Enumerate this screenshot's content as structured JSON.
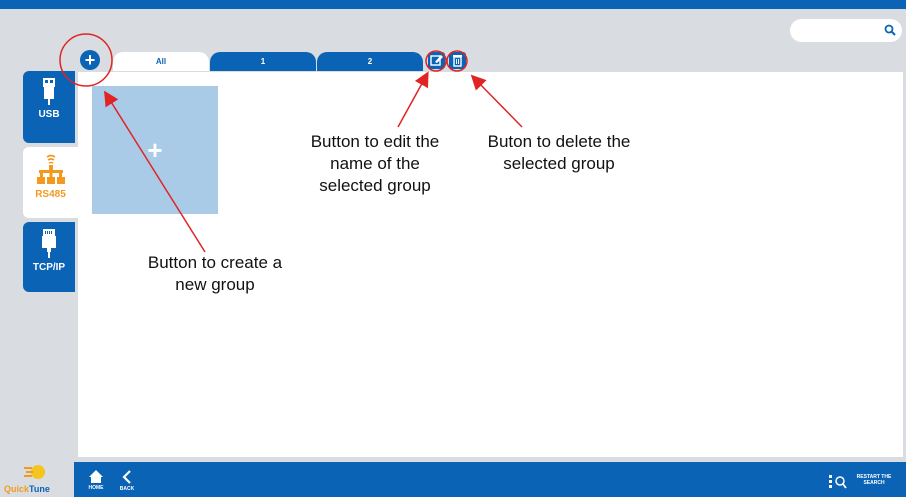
{
  "search": {
    "placeholder": ""
  },
  "sidebar": {
    "items": [
      {
        "label": "USB",
        "icon": "usb-icon",
        "active": false
      },
      {
        "label": "RS485",
        "icon": "rs485-network-icon",
        "active": true
      },
      {
        "label": "TCP/IP",
        "icon": "ethernet-icon",
        "active": false
      }
    ]
  },
  "tabs": [
    {
      "label": "All",
      "active": true
    },
    {
      "label": "1",
      "active": false
    },
    {
      "label": "2",
      "active": false
    }
  ],
  "annotations": {
    "create": "Button to create a new group",
    "edit": "Button to edit the name of the selected group",
    "delete": "Buton to delete the selected group"
  },
  "bottom": {
    "logo_text_quick": "Quick",
    "logo_text_tune": "Tune",
    "home_label": "HOME",
    "back_label": "BACK",
    "restart_label": "RESTART THE SEARCH"
  },
  "colors": {
    "primary": "#0b63b5",
    "accent": "#f39a1e",
    "tile": "#a9cbe8",
    "annotation": "#e02424"
  }
}
